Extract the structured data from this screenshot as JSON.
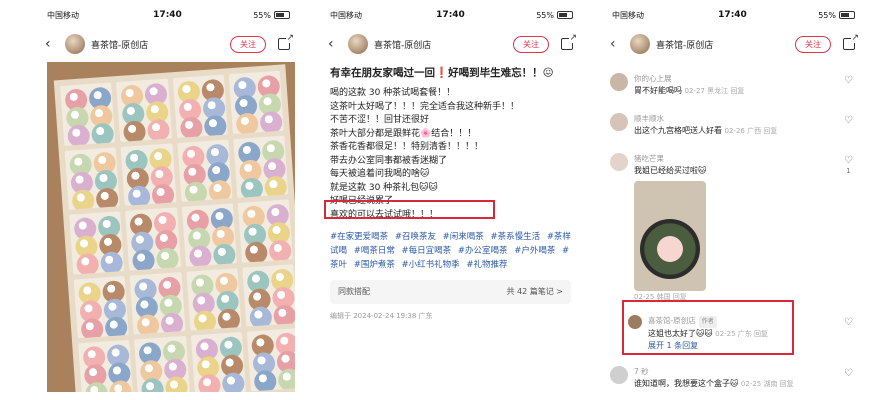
{
  "status": {
    "carrier": "中国移动",
    "time": "17:40",
    "battery": "55%"
  },
  "header": {
    "shop_name": "喜茶馆-原创店",
    "follow_label": "关注"
  },
  "post": {
    "title": "有幸在朋友家喝过一回❗好喝到毕生难忘！！😖",
    "lines": [
      "喝的这款 30 种茶试喝套餐！！",
      "这茶叶太好喝了！！！完全适合我这种新手！！",
      "不苦不涩！！回甘还很好",
      "茶叶大部分都是跟鲜花🌸结合！！！",
      "茶香花香都很足！！特别清香！！！！",
      "带去办公室同事都被香迷糊了",
      "每天被追着问我喝的啥🐱",
      "就是这款 30 种茶礼包🐱🐱",
      "好喝已经说累了",
      "喜欢的可以去试试哦！！！"
    ],
    "tags": [
      "#在家更爱喝茶",
      "#召唤茶友",
      "#闲来喝茶",
      "#茶系慢生活",
      "#茶样试喝",
      "#喝茶日常",
      "#每日宜喝茶",
      "#办公室喝茶",
      "#户外喝茶",
      "#茶叶",
      "#围炉煮茶",
      "#小红书礼物季",
      "#礼物推荐"
    ],
    "collection_label": "同款搭配",
    "collection_count": "共 42 篇笔记 >",
    "edited": "编辑于 2024-02-24 19:38 广东"
  },
  "comments": [
    {
      "name": "你的心上展",
      "text": "胃不好能喝吗",
      "meta": "02-27 黑龙江 回复",
      "likes": "",
      "avatar_color": "#c9b6a6"
    },
    {
      "name": "顺丰顺水",
      "text": "出这个九宫格吧送人好看",
      "meta": "02-26 广西 回复",
      "likes": "",
      "avatar_color": "#d7c4b7"
    },
    {
      "name": "猪吃芒果",
      "text": "我姐已经给买过啦🐱",
      "meta": "02-25 韩国 回复",
      "likes": "1",
      "avatar_color": "#e3d3cb"
    },
    {
      "name": "喜茶馆-原创店",
      "author_tag": "作者",
      "text": "这姐也太好了🐱🐱",
      "meta": "02-25 广东 回复",
      "likes": "",
      "reply_link": "展开 1 条回复",
      "avatar_color": "#9c7b5e"
    },
    {
      "name": "7 秒",
      "text": "谁知道啊，我想要这个盒子🐱",
      "meta": "02-25 湖南 回复",
      "likes": "",
      "avatar_color": "#cfcfcf"
    }
  ]
}
